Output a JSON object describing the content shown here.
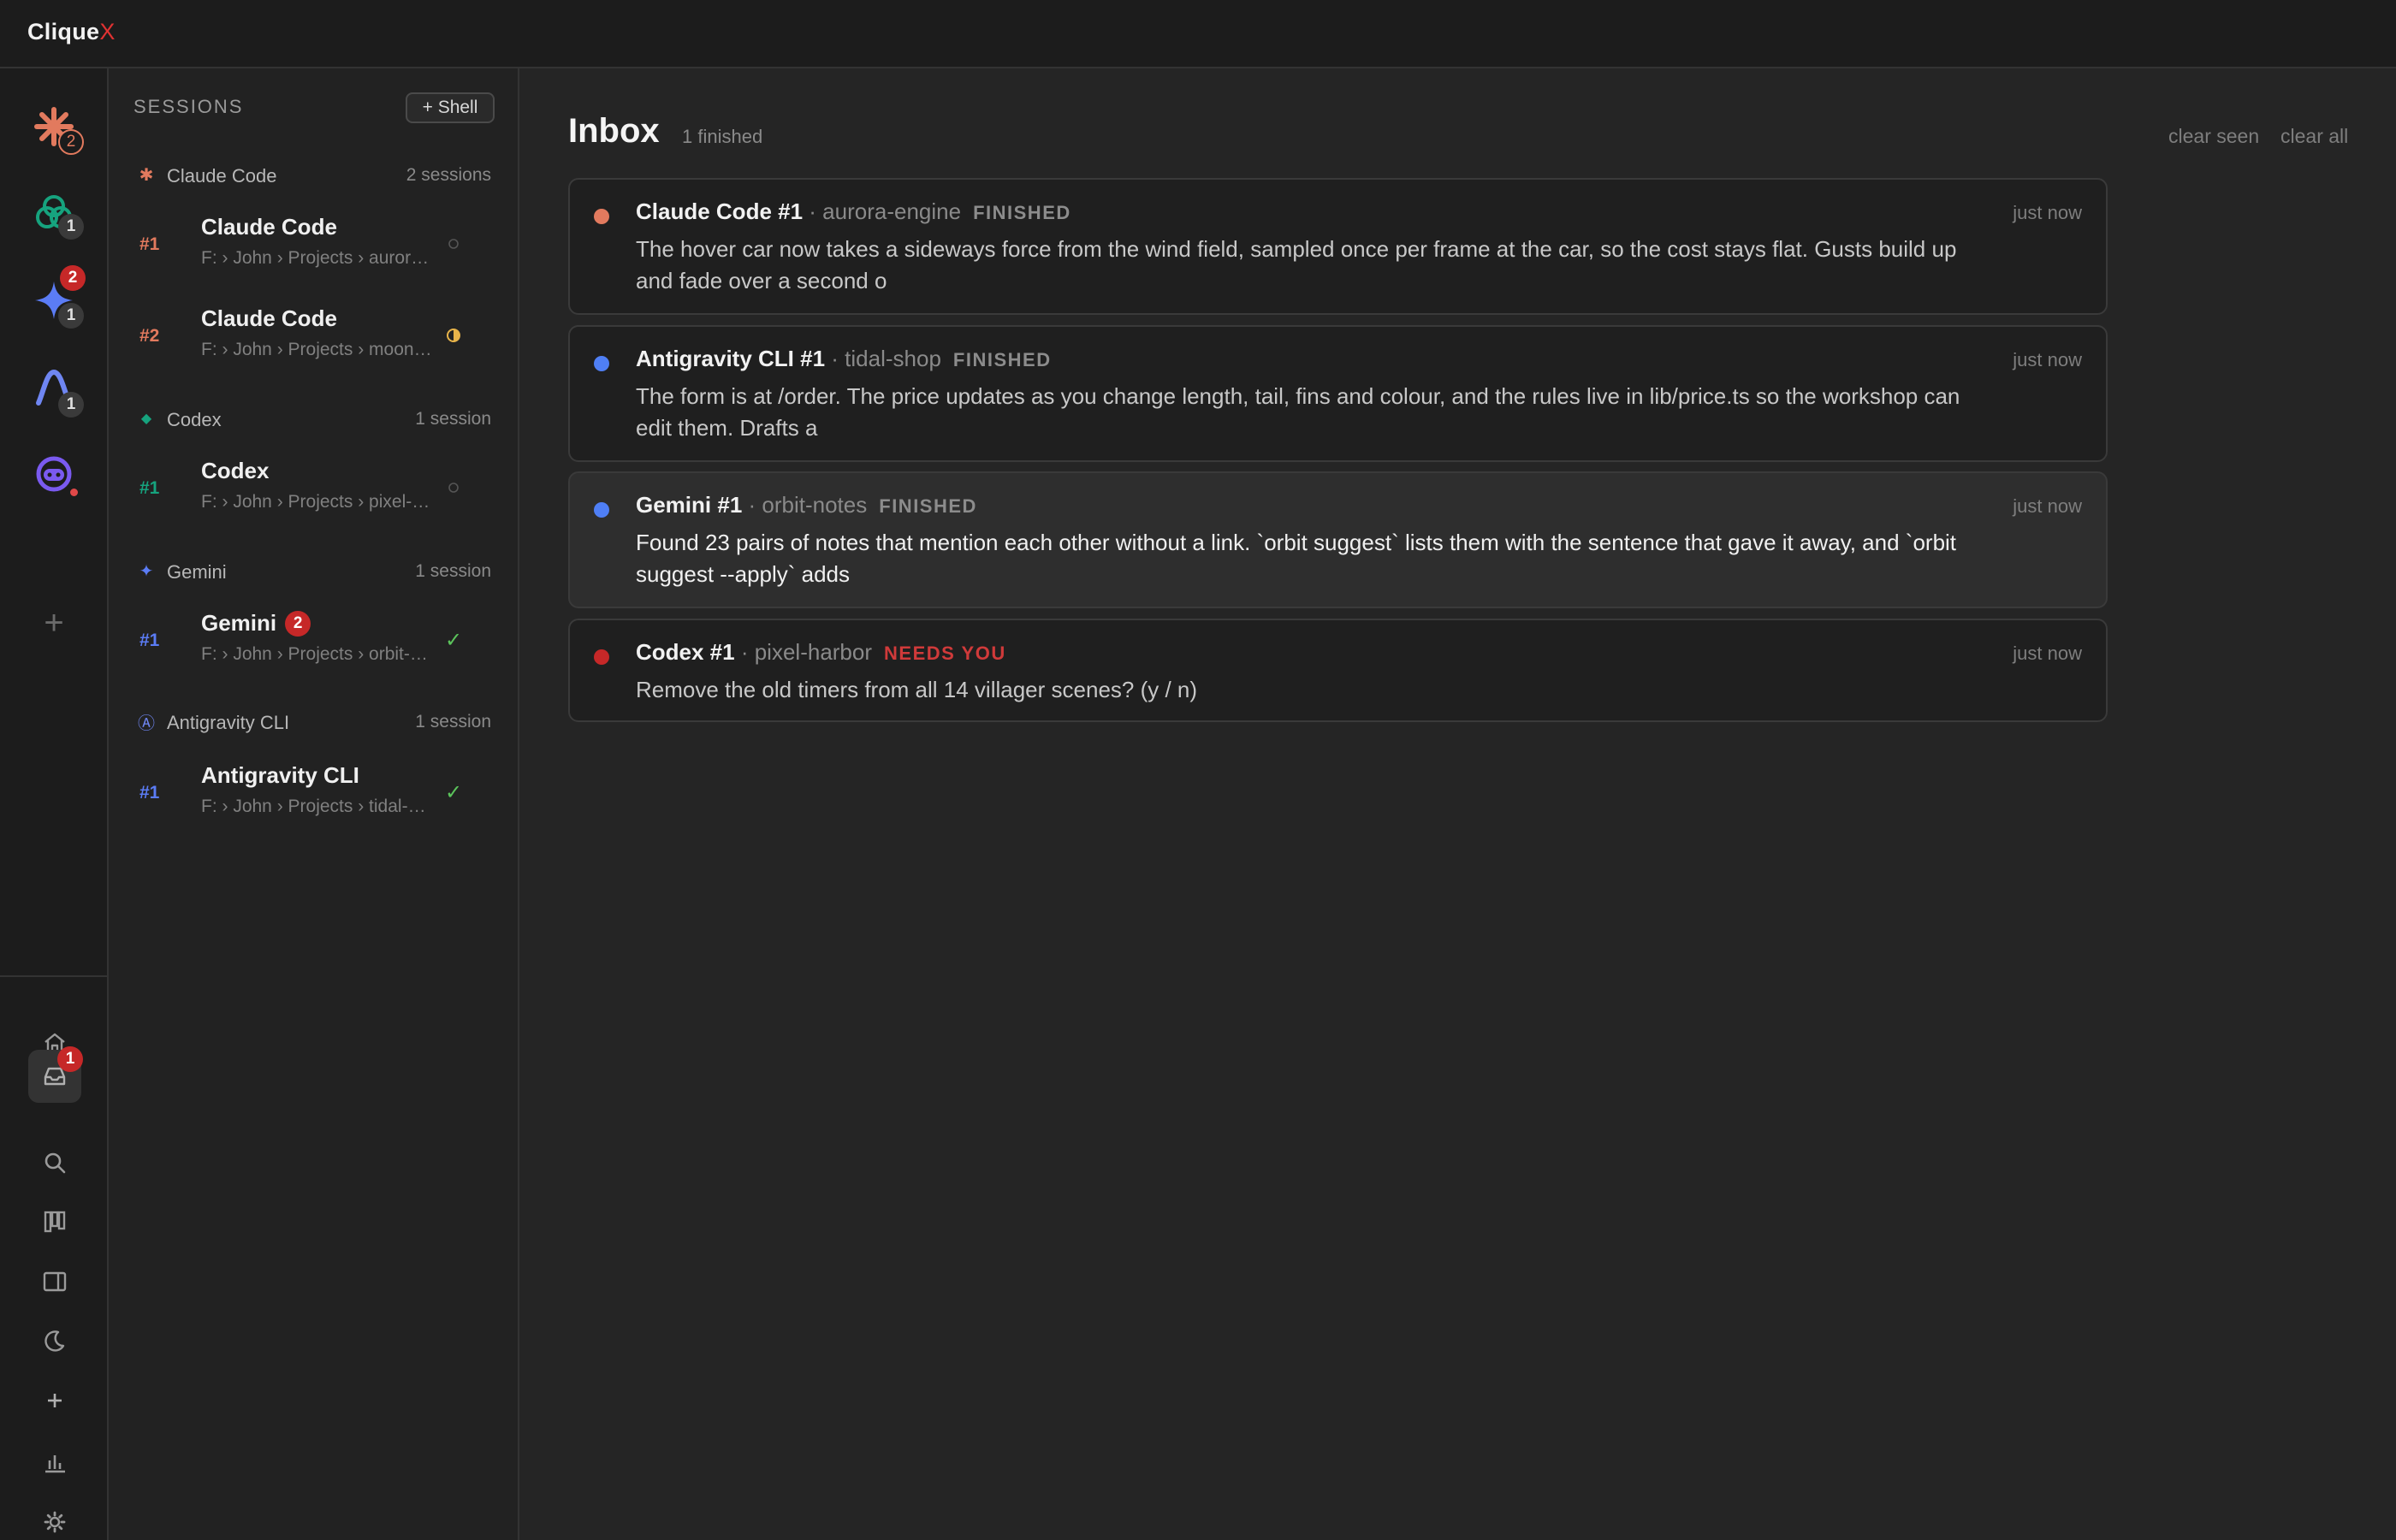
{
  "app": {
    "name": "Clique",
    "name_suffix": "X"
  },
  "rail": {
    "agents": [
      {
        "name": "Claude Code",
        "badge": "2",
        "color": "#e27a5e"
      },
      {
        "name": "Codex",
        "badge": "1",
        "color": "#16a37e"
      },
      {
        "name": "Gemini",
        "badge": "1",
        "alert_badge": "2",
        "color": "#5b7cf5"
      },
      {
        "name": "Antigravity CLI",
        "badge": "1",
        "color": "#6f86f2"
      },
      {
        "name": "Agent",
        "color": "#7a5af0",
        "alert": true
      }
    ],
    "add_icon": "plus-icon",
    "nav": [
      {
        "name": "home-icon"
      },
      {
        "name": "inbox-icon",
        "badge": "1",
        "active": true
      },
      {
        "name": "search-icon"
      },
      {
        "name": "board-icon"
      },
      {
        "name": "panel-icon"
      },
      {
        "name": "moon-icon"
      },
      {
        "name": "plus-icon"
      },
      {
        "name": "stats-icon"
      },
      {
        "name": "settings-icon"
      }
    ]
  },
  "sessions": {
    "title": "SESSIONS",
    "shell_button": "+ Shell",
    "groups": [
      {
        "name": "Claude Code",
        "count": "2 sessions",
        "color": "#e27a5e",
        "icon": "asterisk-icon",
        "items": [
          {
            "num": "#1",
            "name": "Claude Code",
            "path": "F: › John › Projects › aurora-engine",
            "status": "idle"
          },
          {
            "num": "#2",
            "name": "Claude Code",
            "path": "F: › John › Projects › moonlight",
            "status": "working"
          }
        ]
      },
      {
        "name": "Codex",
        "count": "1 session",
        "color": "#16a37e",
        "icon": "diamond-icon",
        "items": [
          {
            "num": "#1",
            "name": "Codex",
            "path": "F: › John › Projects › pixel-harbor",
            "status": "idle"
          }
        ]
      },
      {
        "name": "Gemini",
        "count": "1 session",
        "color": "#5b7cf5",
        "icon": "sparkle-icon",
        "items": [
          {
            "num": "#1",
            "name": "Gemini",
            "badge": "2",
            "path": "F: › John › Projects › orbit-notes",
            "status": "done"
          }
        ]
      },
      {
        "name": "Antigravity CLI",
        "count": "1 session",
        "color": "#6f86f2",
        "icon": "circled-a-icon",
        "items": [
          {
            "num": "#1",
            "name": "Antigravity CLI",
            "path": "F: › John › Projects › tidal-shop",
            "status": "done"
          }
        ]
      }
    ]
  },
  "inbox": {
    "title": "Inbox",
    "subtitle": "1 finished",
    "clear_seen": "clear seen",
    "clear_all": "clear all",
    "items": [
      {
        "name": "Claude Code #1",
        "project": "· aurora-engine",
        "status": "FINISHED",
        "time": "just now",
        "color": "#e27a5e",
        "body": "The hover car now takes a sideways force from the wind field, sampled once per frame at the car, so the cost stays flat. Gusts build up and fade over a second o"
      },
      {
        "name": "Antigravity CLI #1",
        "project": "· tidal-shop",
        "status": "FINISHED",
        "time": "just now",
        "color": "#4f7ff5",
        "body": "The form is at /order. The price updates as you change length, tail, fins and colour, and the rules live in lib/price.ts so the workshop can edit them. Drafts a"
      },
      {
        "name": "Gemini #1",
        "project": "· orbit-notes",
        "status": "FINISHED",
        "time": "just now",
        "color": "#4f7ff5",
        "body": "Found 23 pairs of notes that mention each other without a link. `orbit suggest` lists them with the sentence that gave it away, and `orbit suggest --apply` adds"
      },
      {
        "name": "Codex #1",
        "project": "· pixel-harbor",
        "status": "NEEDS YOU",
        "time": "just now",
        "color": "#c62828",
        "body": "Remove the old timers from all 14 villager scenes? (y / n)"
      }
    ]
  }
}
